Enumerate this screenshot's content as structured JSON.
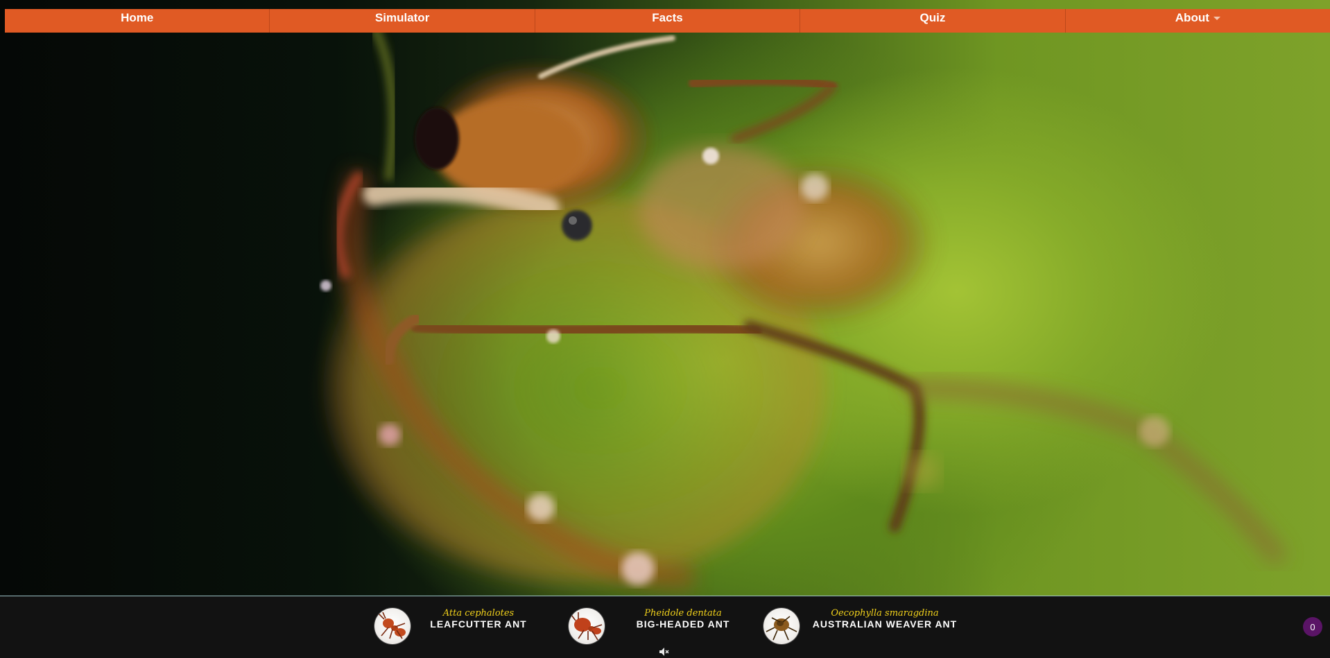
{
  "nav": {
    "items": [
      {
        "label": "Home"
      },
      {
        "label": "Simulator"
      },
      {
        "label": "Facts"
      },
      {
        "label": "Quiz"
      },
      {
        "label": "About",
        "has_dropdown": true
      }
    ]
  },
  "hero": {
    "type": "background-video",
    "subject": "ant-closeup-icon"
  },
  "species_bar": {
    "items": [
      {
        "scientific_name": "Atta cephalotes",
        "common_name": "LEAFCUTTER ANT",
        "icon": "ant-icon"
      },
      {
        "scientific_name": "Pheidole dentata",
        "common_name": "BIG-HEADED ANT",
        "icon": "ant-icon"
      },
      {
        "scientific_name": "Oecophylla smaragdina",
        "common_name": "AUSTRALIAN WEAVER ANT",
        "icon": "ant-icon"
      }
    ],
    "mute_icon": "speaker-muted-icon",
    "counter": "0"
  },
  "colors": {
    "nav_bg": "#e05a24",
    "bar_bg": "#121212",
    "sci_name": "#f2d21b",
    "counter_bg": "#5a1466"
  }
}
